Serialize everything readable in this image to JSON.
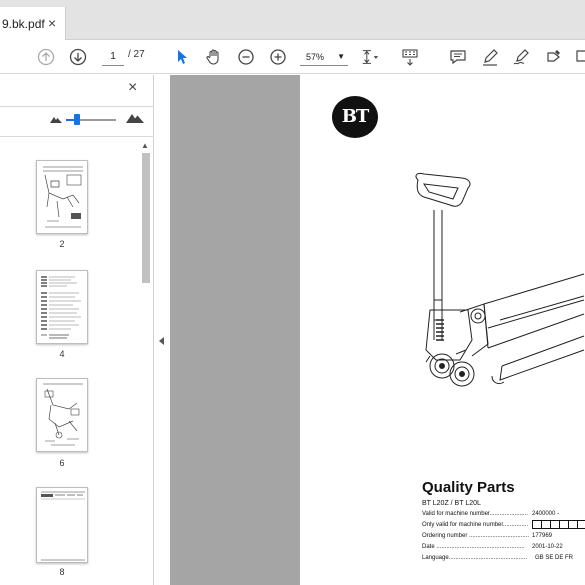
{
  "tab": {
    "title": "9.bk.pdf",
    "close": "×"
  },
  "toolbar": {
    "page_current": "1",
    "page_total": "/ 27",
    "zoom": "57%",
    "zoom_caret": "▼"
  },
  "sidebar": {
    "close": "×",
    "scroll_up": "▲",
    "thumbnails": [
      {
        "label": "2"
      },
      {
        "label": "4"
      },
      {
        "label": "6"
      },
      {
        "label": "8"
      }
    ]
  },
  "document": {
    "logo_text": "BT",
    "title": "Quality Parts",
    "models": "BT L20Z / BT L20L",
    "rows": [
      {
        "label": "Valid for machine number.......................",
        "value": "2400000 -"
      },
      {
        "label": "Only valid for machine number...............",
        "value": ""
      },
      {
        "label": "Ordering number ....................................",
        "value": "177969"
      },
      {
        "label": "Date .....................................................",
        "value": "2001-10-22"
      },
      {
        "label": "Language...............................................",
        "value": "GB SE DE FR"
      }
    ]
  },
  "colors": {
    "accent": "#1473e6",
    "viewer_bg": "#a5a5a5",
    "tabbar_bg": "#e3e3e3"
  }
}
